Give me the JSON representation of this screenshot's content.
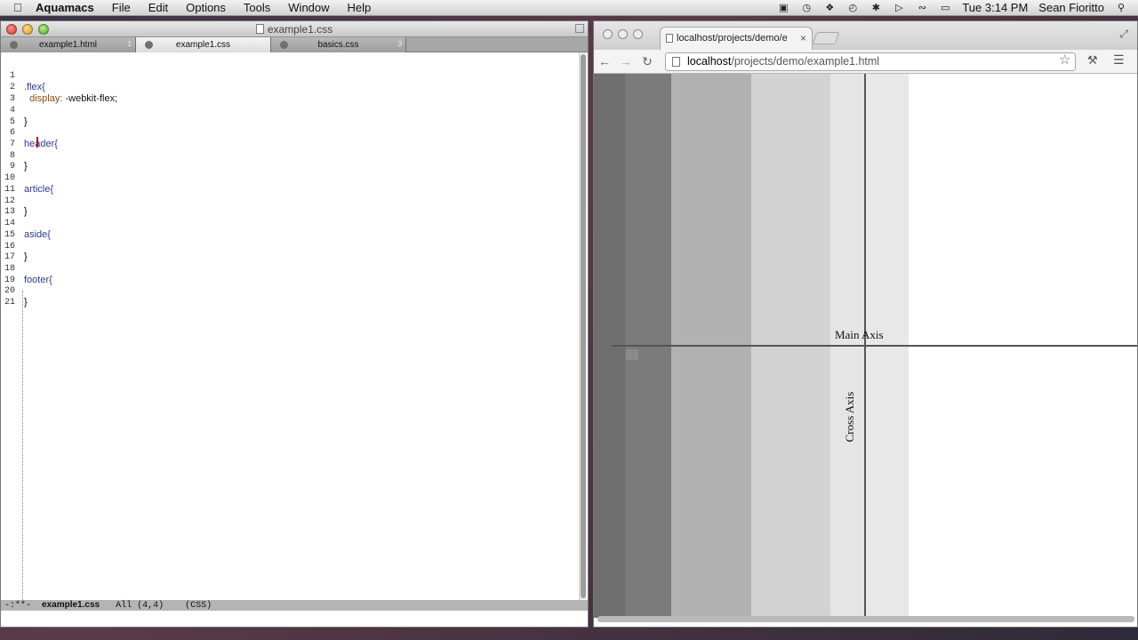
{
  "menubar": {
    "app_name": "Aquamacs",
    "items": [
      "File",
      "Edit",
      "Options",
      "Tools",
      "Window",
      "Help"
    ],
    "clock": "Tue 3:14 PM",
    "user": "Sean Fioritto"
  },
  "emacs": {
    "title": "example1.css",
    "tabs": [
      {
        "label": "example1.html",
        "num": "1",
        "active": false
      },
      {
        "label": "example1.css",
        "num": "2",
        "active": true
      },
      {
        "label": "basics.css",
        "num": "3",
        "active": false
      }
    ],
    "lines": [
      {
        "n": "1",
        "text": ""
      },
      {
        "n": "2",
        "sel": ".flex{",
        "rest": ""
      },
      {
        "n": "3",
        "prop": "  display: ",
        "val": "-webkit-flex;"
      },
      {
        "n": "4",
        "text": ""
      },
      {
        "n": "5",
        "text": "}"
      },
      {
        "n": "6",
        "text": ""
      },
      {
        "n": "7",
        "sel": "header{",
        "rest": ""
      },
      {
        "n": "8",
        "text": ""
      },
      {
        "n": "9",
        "text": "}"
      },
      {
        "n": "10",
        "text": ""
      },
      {
        "n": "11",
        "sel": "article{",
        "rest": ""
      },
      {
        "n": "12",
        "text": ""
      },
      {
        "n": "13",
        "text": "}"
      },
      {
        "n": "14",
        "text": ""
      },
      {
        "n": "15",
        "sel": "aside{",
        "rest": ""
      },
      {
        "n": "16",
        "text": ""
      },
      {
        "n": "17",
        "text": "}"
      },
      {
        "n": "18",
        "text": ""
      },
      {
        "n": "19",
        "sel": "footer{",
        "rest": ""
      },
      {
        "n": "20",
        "text": ""
      },
      {
        "n": "21",
        "text": "}"
      }
    ],
    "modeline": {
      "prefix": "-:**-",
      "buffer": "example1.css",
      "position": "All (4,4)",
      "mode": "(CSS)"
    }
  },
  "chrome": {
    "tab_title": "localhost/projects/demo/e",
    "url_host": "localhost",
    "url_path": "/projects/demo/example1.html",
    "labels": {
      "main_axis": "Main Axis",
      "cross_axis": "Cross Axis"
    },
    "colors": {
      "col1": "#6e6e6e",
      "col2": "#7b7b7b",
      "col3": "#b1b1b1",
      "col4": "#d3d3d3",
      "col5": "#e5e5e5",
      "col6": "#e8e8e8"
    }
  }
}
